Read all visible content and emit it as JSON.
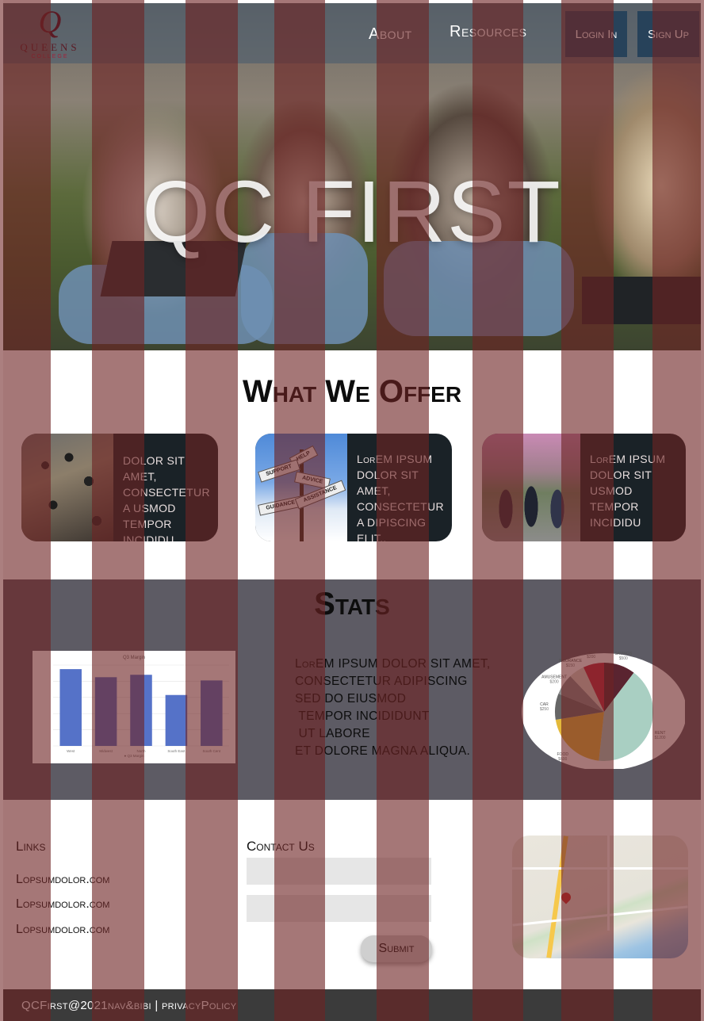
{
  "nav": {
    "logo_q": "Q",
    "logo_name": "QUEENS",
    "logo_sub": "COLLEGE",
    "about": "About",
    "resources": "Resources",
    "login": "Login In",
    "signup": "Sign Up"
  },
  "hero": {
    "title": "QC FIRST"
  },
  "offer": {
    "title": "What We Offer",
    "cards": [
      {
        "text": "dolor sit amet, consectetur a usmod tempor incididu"
      },
      {
        "lead": "Lor",
        "text": "em ipsum dolor sit amet, consectetur a dipiscing elit,.",
        "sign_labels": [
          "HELP",
          "SUPPORT",
          "ADVICE",
          "GUIDANCE",
          "ASSISTANCE"
        ]
      },
      {
        "lead": "Lor",
        "text": "em ipsum dolor sit usmod tempor incididu"
      }
    ]
  },
  "stats": {
    "title": "Stats",
    "text_lead": "Lor",
    "text_body": "em ipsum dolor sit amet,\nconsectetur adipiscing\nsed do eiusmod\n tempor incididunt\n ut labore\net dolore magna aliqua."
  },
  "chart_data": [
    {
      "type": "bar",
      "title": "Q3 Margin",
      "categories": [
        "West",
        "Midwest",
        "North",
        "South East",
        "South Cent"
      ],
      "values": [
        95,
        85,
        88,
        63,
        81
      ],
      "ylim": [
        0,
        100
      ],
      "legend": "Q3 Margin",
      "color": "#5572c8"
    },
    {
      "type": "pie",
      "labels": [
        "SAVINGS",
        "RENT",
        "FOOD",
        "CAR",
        "AMUSEMENT",
        "INSURANCE",
        "GAS"
      ],
      "values": [
        300,
        1200,
        600,
        250,
        200,
        150,
        200
      ],
      "value_labels": [
        "$500",
        "$1200",
        "$600",
        "$250",
        "$200",
        "$150",
        "$200"
      ],
      "colors": [
        "#5a2430",
        "#a9cfc2",
        "#e3b93a",
        "#666666",
        "#8a8a8a",
        "#d9d6c8",
        "#c0263d"
      ]
    }
  ],
  "footer": {
    "links_title": "Links",
    "links": [
      "Lopsumdolor.com",
      "Lopsumdolor.com",
      "Lopsumdolor.com"
    ],
    "contact_title": "Contact Us",
    "submit": "Submit",
    "copyright": "QCFirst@2021nav&bibi | privacyPolicy"
  },
  "colors": {
    "nav_bg": "#46596e",
    "stats_bg": "#5d5b64",
    "card_bg": "#1a2227",
    "stripe": "#6e2323",
    "footer_bg": "#3b3b3b"
  }
}
